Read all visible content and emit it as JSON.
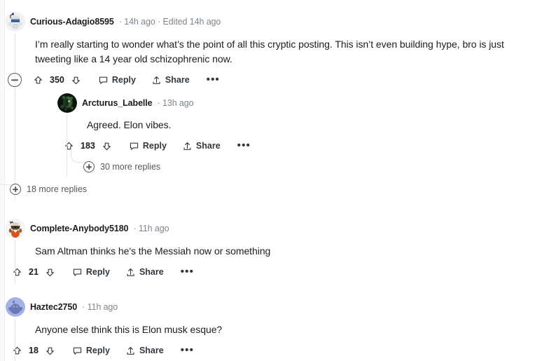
{
  "thread": {
    "comments": [
      {
        "id": "c1",
        "author": "Curious-Adagio8595",
        "timestamp": "14h ago",
        "edited": "Edited 14h ago",
        "separator": "·",
        "avatar": "astronaut-snoo-avatar",
        "body": "I’m really starting to wonder what’s the point of all this cryptic posting. This isn’t even building hype, bro is just tweeting like a 14 year old schizophrenic now.",
        "score": "350",
        "collapse_icon": "collapse-minus-icon",
        "upvote_icon": "upvote-arrow-icon",
        "downvote_icon": "downvote-arrow-icon",
        "reply_label": "Reply",
        "reply_icon": "comment-bubble-icon",
        "share_label": "Share",
        "share_icon": "share-arrow-icon",
        "overflow_icon": "overflow-dots-icon",
        "overflow_label": "•••",
        "reply": {
          "id": "c1r1",
          "author": "Arcturus_Labelle",
          "timestamp": "13h ago",
          "separator": "·",
          "avatar": "dark-portrait-avatar",
          "body": "Agreed. Elon vibes.",
          "score": "183",
          "reply_label": "Reply",
          "share_label": "Share",
          "overflow_label": "•••",
          "more_replies": "30 more replies"
        },
        "more_replies": "18 more replies"
      },
      {
        "id": "c2",
        "author": "Complete-Anybody5180",
        "timestamp": "11h ago",
        "separator": "·",
        "avatar": "sunglasses-snoo-avatar",
        "body": "Sam Altman thinks he's the Messiah now or something",
        "score": "21",
        "reply_label": "Reply",
        "share_label": "Share",
        "overflow_label": "•••"
      },
      {
        "id": "c3",
        "author": "Haztec2750",
        "timestamp": "11h ago",
        "separator": "·",
        "avatar": "default-snoo-avatar",
        "body": "Anyone else think this is Elon musk esque?",
        "score": "18",
        "reply_label": "Reply",
        "share_label": "Share",
        "overflow_label": "•••"
      }
    ]
  },
  "colors": {
    "text": "#1c1c1c",
    "meta": "#7c858d",
    "action": "#33383c",
    "thread_line": "#e2e4e6",
    "page_bg": "#ffffff",
    "gutter": "#f7f8f9",
    "avatar_blue": "#a5b2e8"
  }
}
